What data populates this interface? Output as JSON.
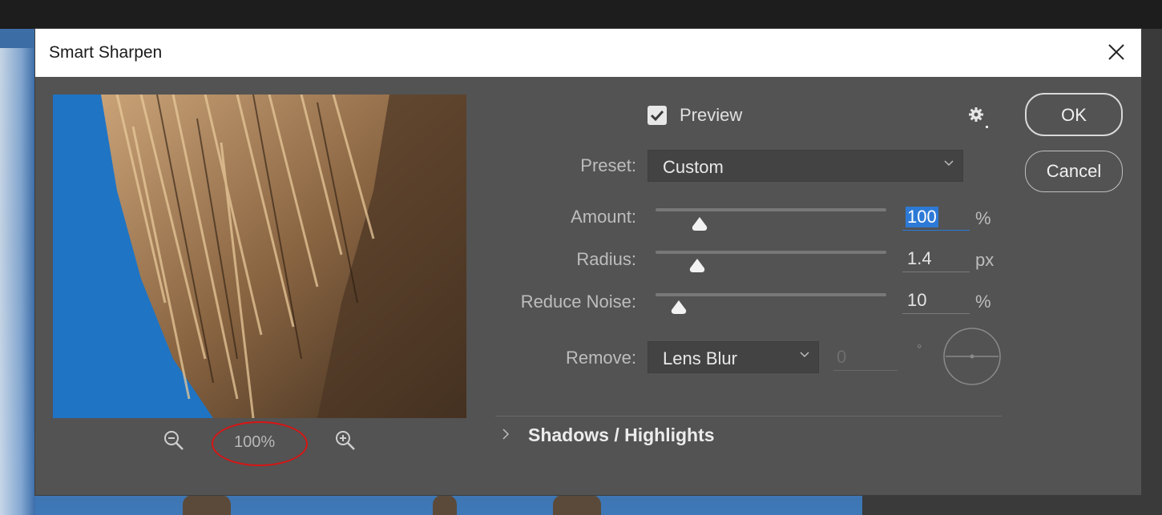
{
  "dialog": {
    "title": "Smart Sharpen",
    "close_icon": "close-icon"
  },
  "preview": {
    "label": "Preview",
    "checked": true,
    "zoom_level": "100%"
  },
  "buttons": {
    "ok": "OK",
    "cancel": "Cancel"
  },
  "preset": {
    "label": "Preset:",
    "value": "Custom"
  },
  "sliders": [
    {
      "label": "Amount:",
      "value": "100",
      "unit": "%",
      "position": 0.19
    },
    {
      "label": "Radius:",
      "value": "1.4",
      "unit": "px",
      "position": 0.18
    },
    {
      "label": "Reduce Noise:",
      "value": "10",
      "unit": "%",
      "position": 0.1
    }
  ],
  "remove": {
    "label": "Remove:",
    "value": "Lens Blur",
    "angle": "0",
    "degree_symbol": "°"
  },
  "section": {
    "title": "Shadows / Highlights"
  },
  "colors": {
    "dialog_bg": "#535353",
    "accent_blue": "#2d7ad6",
    "annotation_red": "#d81414"
  }
}
